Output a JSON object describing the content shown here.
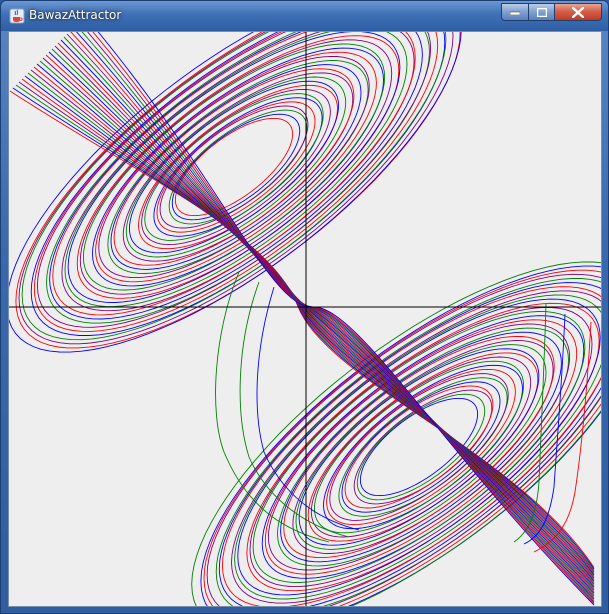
{
  "window": {
    "title": "BawazAttractor",
    "controls": {
      "minimize": "minimize-icon",
      "maximize": "maximize-icon",
      "close": "close-icon"
    },
    "app_icon": "java-cup-icon"
  },
  "plot": {
    "background": "#eeeeee",
    "axis_color": "#000000",
    "series_colors": [
      "#ff0000",
      "#0000ff",
      "#008000",
      "#800080"
    ]
  }
}
